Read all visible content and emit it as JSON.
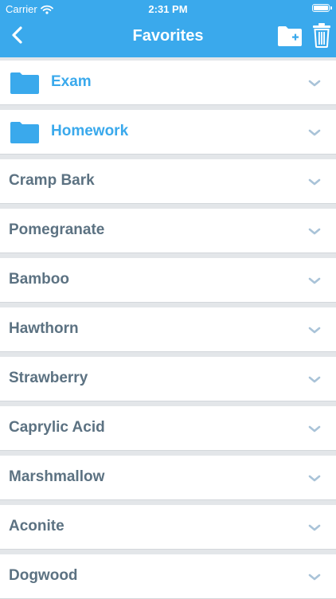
{
  "status_bar": {
    "carrier": "Carrier",
    "time": "2:31 PM",
    "battery_level": 1.0
  },
  "nav": {
    "title": "Favorites",
    "back_icon": "chevron-left-icon",
    "add_folder_icon": "folder-plus-icon",
    "trash_icon": "trash-icon"
  },
  "folders": [
    {
      "label": "Exam",
      "icon": "folder-icon"
    },
    {
      "label": "Homework",
      "icon": "folder-icon"
    }
  ],
  "items": [
    {
      "label": "Cramp Bark"
    },
    {
      "label": "Pomegranate"
    },
    {
      "label": "Bamboo"
    },
    {
      "label": "Hawthorn"
    },
    {
      "label": "Strawberry"
    },
    {
      "label": "Caprylic Acid"
    },
    {
      "label": "Marshmallow"
    },
    {
      "label": "Aconite"
    },
    {
      "label": "Dogwood"
    }
  ],
  "colors": {
    "accent": "#3aa9ec",
    "item_text": "#5c7282",
    "chevron": "#a9c3d8",
    "background": "#e3e6e9"
  }
}
